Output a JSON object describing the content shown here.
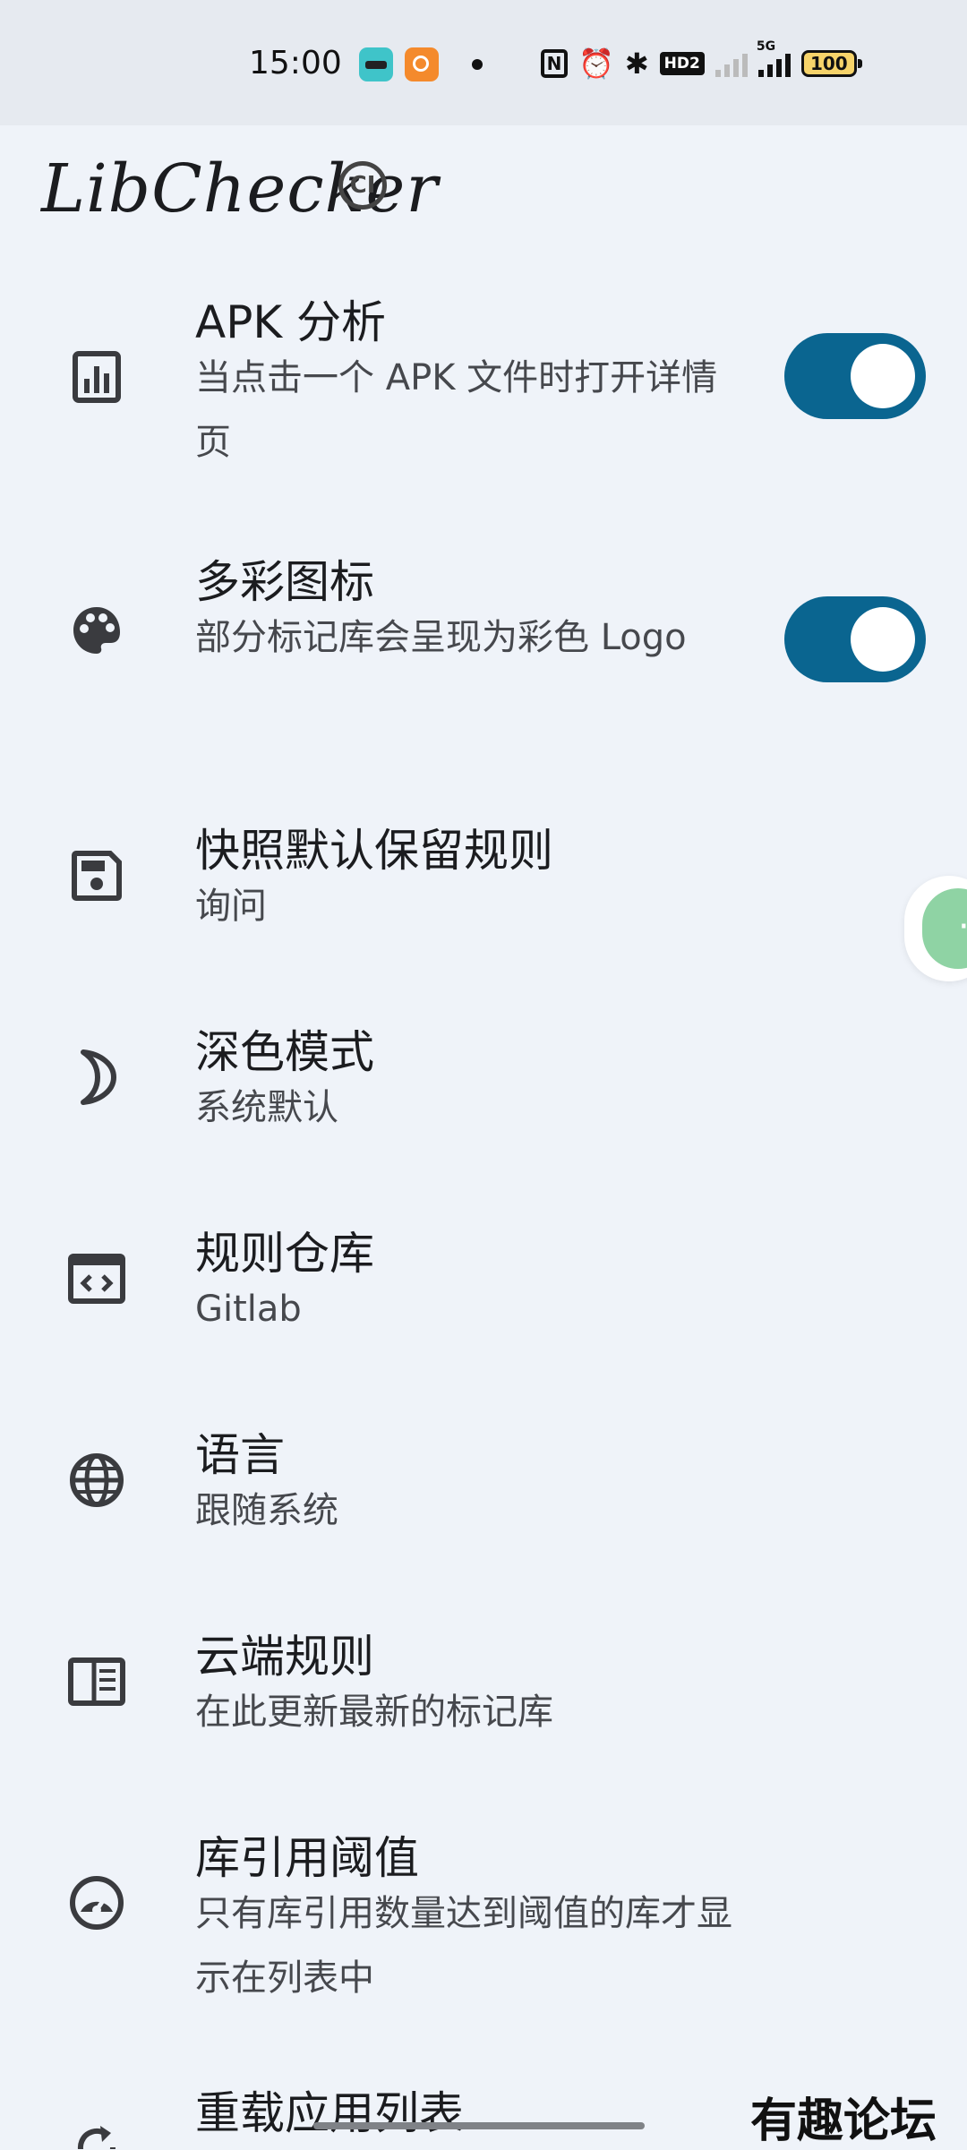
{
  "status_bar": {
    "time": "15:00",
    "hd_label": "HD2",
    "network_label": "5G",
    "battery": "100"
  },
  "app_bar": {
    "title": "LibChecker",
    "badge": "CI"
  },
  "settings": [
    {
      "icon": "bar-chart-icon",
      "title": "APK 分析",
      "summary": "当点击一个 APK 文件时打开详情页",
      "toggle": true
    },
    {
      "icon": "palette-icon",
      "title": "多彩图标",
      "summary": "部分标记库会呈现为彩色 Logo",
      "toggle": true
    },
    {
      "icon": "save-icon",
      "title": "快照默认保留规则",
      "summary": "询问"
    },
    {
      "icon": "moon-icon",
      "title": "深色模式",
      "summary": "系统默认"
    },
    {
      "icon": "code-window-icon",
      "title": "规则仓库",
      "summary": "Gitlab"
    },
    {
      "icon": "globe-icon",
      "title": "语言",
      "summary": "跟随系统"
    },
    {
      "icon": "cloud-rules-icon",
      "title": "云端规则",
      "summary": "在此更新最新的标记库"
    },
    {
      "icon": "speedometer-icon",
      "title": "库引用阈值",
      "summary": "只有库引用数量达到阈值的库才显示在列表中"
    },
    {
      "icon": "reload-icon",
      "title": "重载应用列表",
      "summary": ""
    }
  ],
  "watermark": "有趣论坛",
  "colors": {
    "background": "#eff3f9",
    "status_bar": "#e6eaf0",
    "switch_track": "#0a6590",
    "text_primary": "#1b1c1f",
    "text_secondary": "#46484d"
  }
}
